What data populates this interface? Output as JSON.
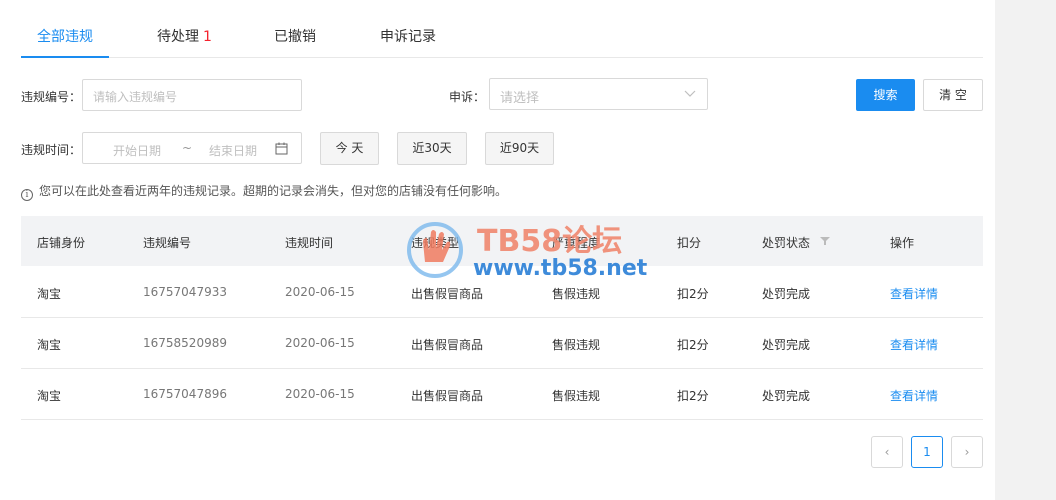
{
  "tabs": [
    {
      "label": "全部违规"
    },
    {
      "label": "待处理",
      "badge": "1"
    },
    {
      "label": "已撤销"
    },
    {
      "label": "申诉记录"
    }
  ],
  "filters": {
    "violation_id_label": "违规编号：",
    "violation_id_placeholder": "请输入违规编号",
    "appeal_label": "申诉：",
    "appeal_placeholder": "请选择",
    "time_label": "违规时间：",
    "start_placeholder": "开始日期",
    "range_sep": "~",
    "end_placeholder": "结束日期",
    "today": "今 天",
    "last30": "近30天",
    "last90": "近90天",
    "search": "搜索",
    "clear": "清 空"
  },
  "notice": "您可以在此处查看近两年的违规记录。超期的记录会消失，但对您的店铺没有任何影响。",
  "table": {
    "headers": [
      "店铺身份",
      "违规编号",
      "违规时间",
      "违规类型",
      "严重程度",
      "扣分",
      "处罚状态",
      "操作"
    ],
    "rows": [
      [
        "淘宝",
        "16757047933",
        "2020-06-15",
        "出售假冒商品",
        "售假违规",
        "扣2分",
        "处罚完成",
        "查看详情"
      ],
      [
        "淘宝",
        "16758520989",
        "2020-06-15",
        "出售假冒商品",
        "售假违规",
        "扣2分",
        "处罚完成",
        "查看详情"
      ],
      [
        "淘宝",
        "16757047896",
        "2020-06-15",
        "出售假冒商品",
        "售假违规",
        "扣2分",
        "处罚完成",
        "查看详情"
      ]
    ]
  },
  "pagination": {
    "prev": "‹",
    "current": "1",
    "next": "›"
  },
  "watermark": {
    "title": "TB58论坛",
    "url": "www.tb58.net"
  },
  "colors": {
    "accent": "#1a8cf0",
    "badge": "#f5222d",
    "watermark_title": "#f0886f",
    "watermark_url": "#2a7fd6"
  }
}
